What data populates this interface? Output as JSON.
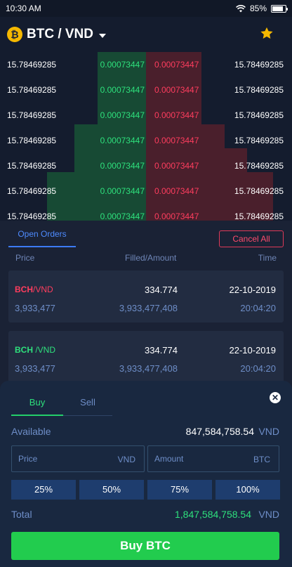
{
  "status_bar": {
    "time": "10:30 AM",
    "battery": "85%",
    "battery_level": 0.85
  },
  "header": {
    "pair": "BTC / VND",
    "coin_symbol": "₿"
  },
  "order_book": {
    "rows": [
      {
        "price": "15.78469285",
        "bid": "0.00073447",
        "ask": "0.00073447",
        "total": "15.78469285",
        "bid_depth": 0.33,
        "ask_depth": 0.38
      },
      {
        "price": "15.78469285",
        "bid": "0.00073447",
        "ask": "0.00073447",
        "total": "15.78469285",
        "bid_depth": 0.33,
        "ask_depth": 0.38
      },
      {
        "price": "15.78469285",
        "bid": "0.00073447",
        "ask": "0.00073447",
        "total": "15.78469285",
        "bid_depth": 0.33,
        "ask_depth": 0.38
      },
      {
        "price": "15.78469285",
        "bid": "0.00073447",
        "ask": "0.00073447",
        "total": "15.78469285",
        "bid_depth": 0.49,
        "ask_depth": 0.54
      },
      {
        "price": "15.78469285",
        "bid": "0.00073447",
        "ask": "0.00073447",
        "total": "15.78469285",
        "bid_depth": 0.49,
        "ask_depth": 0.69
      },
      {
        "price": "15.78469285",
        "bid": "0.00073447",
        "ask": "0.00073447",
        "total": "15.78469285",
        "bid_depth": 0.68,
        "ask_depth": 0.87
      },
      {
        "price": "15.78469285",
        "bid": "0.00073447",
        "ask": "0.00073447",
        "total": "15.78469285",
        "bid_depth": 0.68,
        "ask_depth": 0.87
      }
    ]
  },
  "open_orders": {
    "tab_label": "Open Orders",
    "cancel_all": "Cancel All",
    "headers": {
      "price": "Price",
      "filled": "Filled/Amount",
      "time": "Time"
    },
    "items": [
      {
        "coin": "BCH",
        "quote": "/VND",
        "coin_color": "#ff3d5e",
        "filled": "334.774",
        "date": "22-10-2019",
        "price": "3,933,477",
        "amount": "3,933,477,408",
        "time": "20:04:20"
      },
      {
        "coin": "BCH",
        "quote": " /VND",
        "coin_color": "#2ee07c",
        "filled": "334.774",
        "date": "22-10-2019",
        "price": "3,933,477",
        "amount": "3,933,477,408",
        "time": "20:04:20"
      }
    ]
  },
  "trade_panel": {
    "tabs": {
      "buy": "Buy",
      "sell": "Sell"
    },
    "available_label": "Available",
    "available_value": "847,584,758.54",
    "available_unit": "VND",
    "price_placeholder": "Price",
    "price_unit": "VND",
    "amount_placeholder": "Amount",
    "amount_unit": "BTC",
    "percents": [
      "25%",
      "50%",
      "75%",
      "100%"
    ],
    "total_label": "Total",
    "total_value": "1,847,584,758.54",
    "total_unit": "VND",
    "submit": "Buy BTC",
    "close": "✕"
  }
}
